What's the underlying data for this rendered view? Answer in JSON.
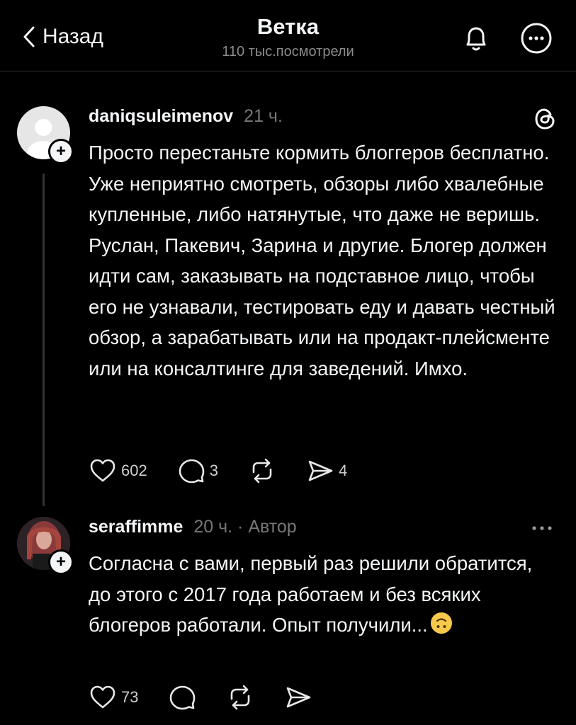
{
  "header": {
    "back_label": "Назад",
    "title": "Ветка",
    "views": "110 тыс.посмотрели",
    "bell_icon": "bell-icon",
    "more_icon": "more-circle-icon"
  },
  "posts": [
    {
      "username": "daniqsuleimenov",
      "time": "21 ч.",
      "text": "Просто перестаньте кормить блоггеров бесплатно. Уже неприятно смотреть, обзоры либо хвалебные купленные, либо натянутые, что даже не веришь. Руслан, Пакевич, Зарина и другие. Блогер должен идти сам, заказывать на подставное лицо, чтобы его не узнавали, тестировать еду и давать честный обзор, а зарабатывать или на продакт-плейсменте или на консалтинге для заведений. Имхо.",
      "likes": "602",
      "replies": "3",
      "shares": "4"
    },
    {
      "username": "seraffimme",
      "time": "20 ч.",
      "author_tag": "· Автор",
      "text": "Согласна с вами, первый раз решили обратится, до этого с 2017 года работаем и без всяких блогеров работали. Опыт получили...",
      "emoji": "upside-down-face",
      "likes": "73"
    }
  ],
  "colors": {
    "background": "#000000",
    "text": "#f3f5f7",
    "muted": "#777777"
  }
}
